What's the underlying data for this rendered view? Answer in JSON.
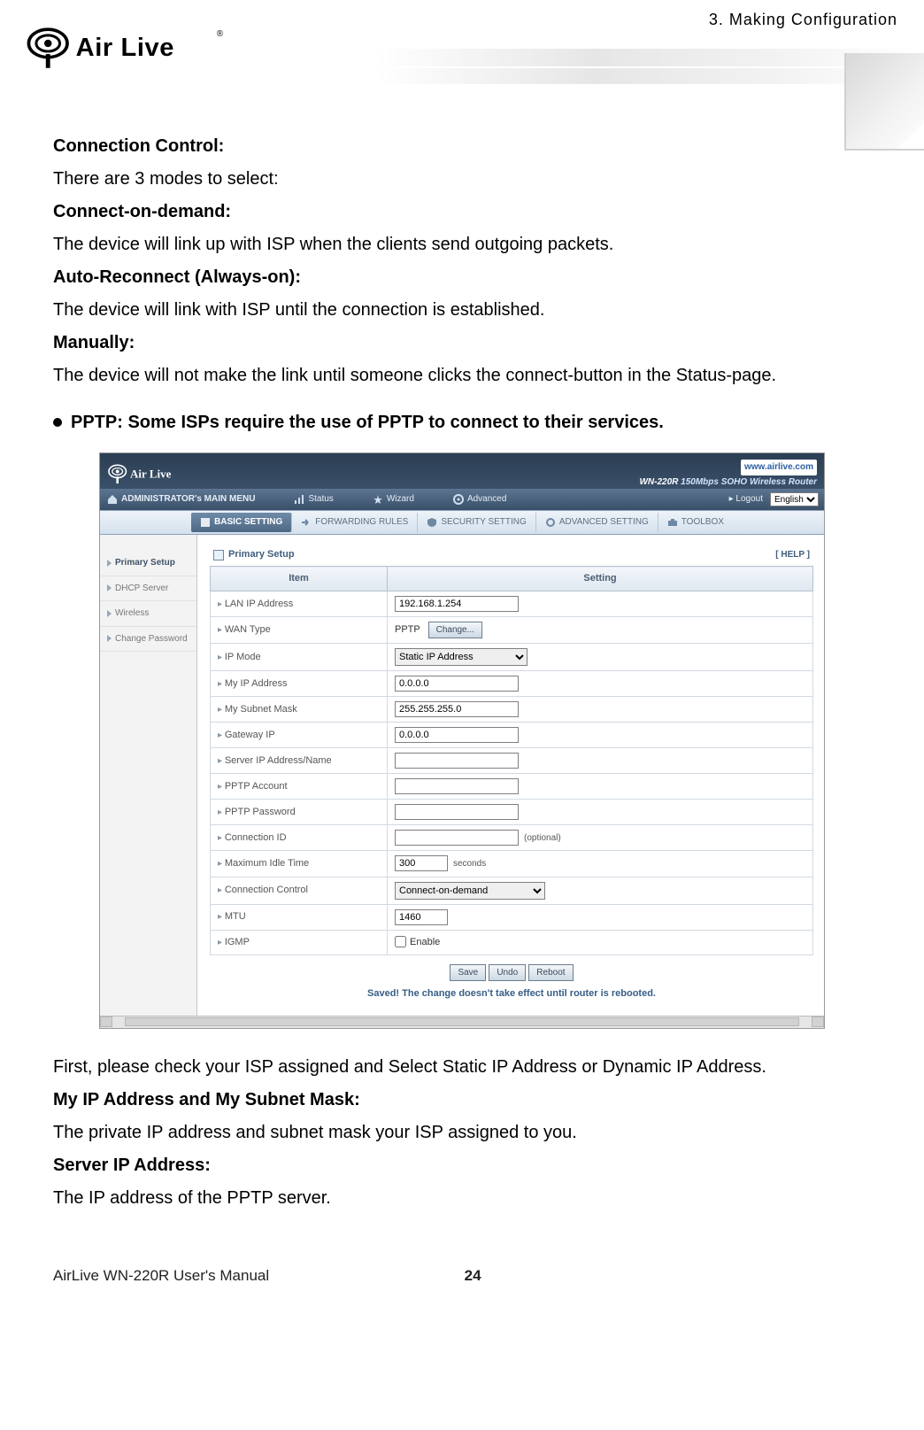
{
  "header": {
    "running_head": "3. Making Configuration",
    "brand": "Air Live",
    "brand_mark": "®"
  },
  "copy": {
    "h_conn_ctrl": "Connection Control:",
    "p_conn_ctrl": "There are 3 modes to select:",
    "h_cod": "Connect-on-demand:",
    "p_cod": "The device will link up with ISP when the clients send outgoing packets.",
    "h_auto": "Auto-Reconnect (Always-on):",
    "p_auto": "The device will link with ISP until the connection is established.",
    "h_manual": "Manually:",
    "p_manual": "The device will not make the link until someone clicks the connect-button in the Status-page.",
    "bullet_pptp": "PPTP: Some ISPs require the use of PPTP to connect to their services.",
    "p_first": "First, please check your ISP assigned and Select Static IP Address or Dynamic IP Address.",
    "h_myip": "My IP Address and My Subnet Mask:",
    "p_myip": "The private IP address and subnet mask your ISP assigned to you.",
    "h_srvip": "Server IP Address:",
    "p_srvip": "The IP address of the PPTP server."
  },
  "shot": {
    "url_badge": "www.airlive.com",
    "model_id": "WN-220R",
    "model_tag": "150Mbps SOHO Wireless Router",
    "nav1": {
      "admin": "ADMINISTRATOR's MAIN MENU",
      "status": "Status",
      "wizard": "Wizard",
      "advanced": "Advanced",
      "logout": "▸ Logout",
      "lang": "English"
    },
    "nav2": {
      "basic": "BASIC SETTING",
      "fwd": "FORWARDING RULES",
      "sec": "SECURITY SETTING",
      "adv": "ADVANCED SETTING",
      "tool": "TOOLBOX"
    },
    "side": [
      "Primary Setup",
      "DHCP Server",
      "Wireless",
      "Change Password"
    ],
    "panel_title": "Primary Setup",
    "help": "[ HELP ]",
    "th_item": "Item",
    "th_setting": "Setting",
    "rows": {
      "lan_ip": {
        "label": "LAN IP Address",
        "value": "192.168.1.254"
      },
      "wan_type": {
        "label": "WAN Type",
        "value": "PPTP",
        "btn": "Change..."
      },
      "ip_mode": {
        "label": "IP Mode",
        "value": "Static IP Address"
      },
      "my_ip": {
        "label": "My IP Address",
        "value": "0.0.0.0"
      },
      "my_mask": {
        "label": "My Subnet Mask",
        "value": "255.255.255.0"
      },
      "gw": {
        "label": "Gateway IP",
        "value": "0.0.0.0"
      },
      "srv": {
        "label": "Server IP Address/Name",
        "value": ""
      },
      "acct": {
        "label": "PPTP Account",
        "value": ""
      },
      "pwd": {
        "label": "PPTP Password",
        "value": ""
      },
      "connid": {
        "label": "Connection ID",
        "value": "",
        "suffix": "(optional)"
      },
      "idle": {
        "label": "Maximum Idle Time",
        "value": "300",
        "suffix": "seconds"
      },
      "cctrl": {
        "label": "Connection Control",
        "value": "Connect-on-demand"
      },
      "mtu": {
        "label": "MTU",
        "value": "1460"
      },
      "igmp": {
        "label": "IGMP",
        "cb_label": "Enable"
      }
    },
    "buttons": {
      "save": "Save",
      "undo": "Undo",
      "reboot": "Reboot"
    },
    "saved_note": "Saved! The change doesn't take effect until router is rebooted."
  },
  "footer": {
    "left": "AirLive WN-220R User's Manual",
    "page": "24"
  }
}
